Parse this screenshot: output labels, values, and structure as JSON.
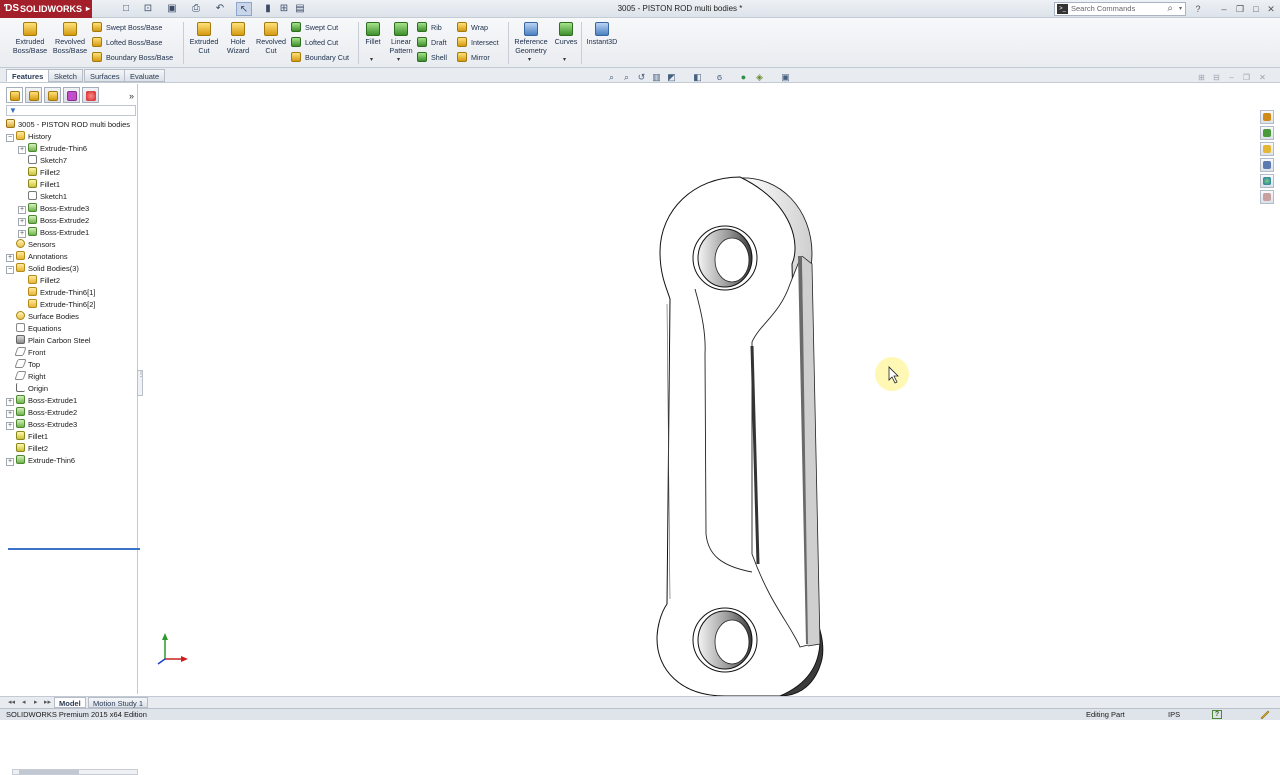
{
  "app": {
    "brand": "SOLIDWORKS",
    "document_title": "3005 - PISTON ROD multi bodies *",
    "search_placeholder": "Search Commands"
  },
  "ribbon": {
    "extruded_boss": "Extruded Boss/Base",
    "revolved_boss": "Revolved Boss/Base",
    "swept_boss": "Swept Boss/Base",
    "lofted_boss": "Lofted Boss/Base",
    "boundary_boss": "Boundary Boss/Base",
    "extruded_cut": "Extruded Cut",
    "hole_wizard": "Hole Wizard",
    "revolved_cut": "Revolved Cut",
    "swept_cut": "Swept Cut",
    "lofted_cut": "Lofted Cut",
    "boundary_cut": "Boundary Cut",
    "fillet": "Fillet",
    "linear_pattern": "Linear Pattern",
    "rib": "Rib",
    "draft": "Draft",
    "shell": "Shell",
    "wrap": "Wrap",
    "intersect": "Intersect",
    "mirror": "Mirror",
    "reference_geometry": "Reference Geometry",
    "curves": "Curves",
    "instant3d": "Instant3D"
  },
  "command_tabs": [
    "Features",
    "Sketch",
    "Surfaces",
    "Evaluate"
  ],
  "tree": {
    "root": "3005 - PISTON ROD multi bodies",
    "items": [
      {
        "label": "History",
        "level": 1,
        "icon": "folder",
        "toggle": "-"
      },
      {
        "label": "Extrude-Thin6",
        "level": 2,
        "icon": "feat",
        "toggle": "+"
      },
      {
        "label": "Sketch7",
        "level": 2,
        "icon": "sketch",
        "toggle": ""
      },
      {
        "label": "Fillet2",
        "level": 2,
        "icon": "fillet",
        "toggle": ""
      },
      {
        "label": "Fillet1",
        "level": 2,
        "icon": "fillet",
        "toggle": ""
      },
      {
        "label": "Sketch1",
        "level": 2,
        "icon": "sketch",
        "toggle": ""
      },
      {
        "label": "Boss-Extrude3",
        "level": 2,
        "icon": "feat",
        "toggle": "+"
      },
      {
        "label": "Boss-Extrude2",
        "level": 2,
        "icon": "feat",
        "toggle": "+"
      },
      {
        "label": "Boss-Extrude1",
        "level": 2,
        "icon": "feat",
        "toggle": "+"
      },
      {
        "label": "Sensors",
        "level": 1,
        "icon": "sensor",
        "toggle": ""
      },
      {
        "label": "Annotations",
        "level": 1,
        "icon": "folder",
        "toggle": "+"
      },
      {
        "label": "Solid Bodies(3)",
        "level": 1,
        "icon": "folder",
        "toggle": "-"
      },
      {
        "label": "Fillet2",
        "level": 2,
        "icon": "folder",
        "toggle": ""
      },
      {
        "label": "Extrude-Thin6[1]",
        "level": 2,
        "icon": "folder",
        "toggle": ""
      },
      {
        "label": "Extrude-Thin6[2]",
        "level": 2,
        "icon": "folder",
        "toggle": ""
      },
      {
        "label": "Surface Bodies",
        "level": 1,
        "icon": "sensor",
        "toggle": ""
      },
      {
        "label": "Equations",
        "level": 1,
        "icon": "eq",
        "toggle": ""
      },
      {
        "label": "Plain Carbon Steel",
        "level": 1,
        "icon": "mat",
        "toggle": ""
      },
      {
        "label": "Front",
        "level": 1,
        "icon": "plane",
        "toggle": ""
      },
      {
        "label": "Top",
        "level": 1,
        "icon": "plane",
        "toggle": ""
      },
      {
        "label": "Right",
        "level": 1,
        "icon": "plane",
        "toggle": ""
      },
      {
        "label": "Origin",
        "level": 1,
        "icon": "origin",
        "toggle": ""
      },
      {
        "label": "Boss-Extrude1",
        "level": 1,
        "icon": "feat",
        "toggle": "+"
      },
      {
        "label": "Boss-Extrude2",
        "level": 1,
        "icon": "feat",
        "toggle": "+"
      },
      {
        "label": "Boss-Extrude3",
        "level": 1,
        "icon": "feat",
        "toggle": "+"
      },
      {
        "label": "Fillet1",
        "level": 1,
        "icon": "fillet",
        "toggle": ""
      },
      {
        "label": "Fillet2",
        "level": 1,
        "icon": "fillet",
        "toggle": ""
      },
      {
        "label": "Extrude-Thin6",
        "level": 1,
        "icon": "feat",
        "toggle": "+"
      }
    ]
  },
  "bottom_tabs": [
    "Model",
    "Motion Study 1"
  ],
  "status": {
    "edition": "SOLIDWORKS Premium 2015 x64 Edition",
    "editing": "Editing Part",
    "units": "IPS",
    "help": "?"
  },
  "colors": {
    "brand_red": "#a3202b",
    "selection_blue": "#3a73c8"
  }
}
